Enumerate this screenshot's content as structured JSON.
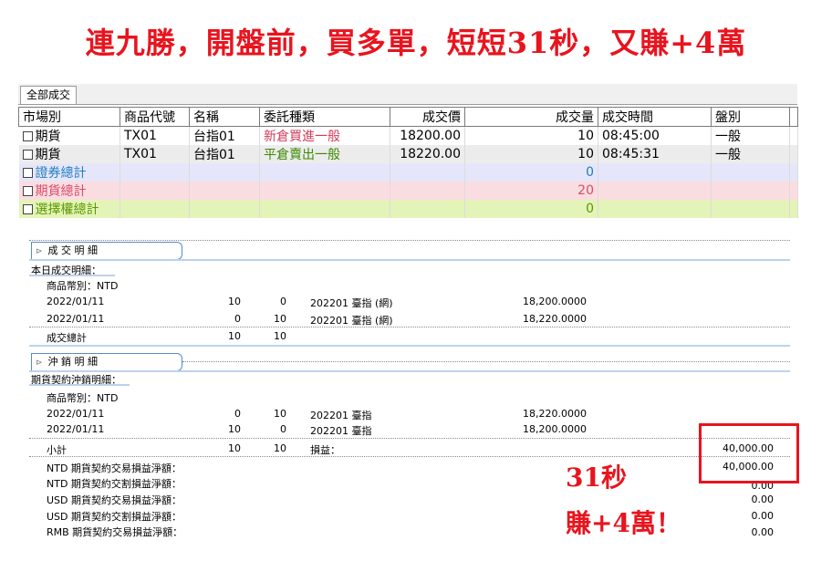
{
  "headline": "連九勝，開盤前，買多單，短短31秒，又賺+4萬",
  "tab": "全部成交",
  "columns": [
    "市場別",
    "商品代號",
    "名稱",
    "委託種類",
    "成交價",
    "成交量",
    "成交時間",
    "盤別"
  ],
  "rows": [
    {
      "market": "期貨",
      "code": "TX01",
      "name": "台指01",
      "type": "新倉買進一般",
      "price": "18200.00",
      "qty": "10",
      "time": "08:45:00",
      "session": "一般"
    },
    {
      "market": "期貨",
      "code": "TX01",
      "name": "台指01",
      "type": "平倉賣出一般",
      "price": "18220.00",
      "qty": "10",
      "time": "08:45:31",
      "session": "一般"
    }
  ],
  "totals": [
    {
      "label": "證券總計",
      "qty": "0"
    },
    {
      "label": "期貨總計",
      "qty": "20"
    },
    {
      "label": "選擇權總計",
      "qty": "0"
    }
  ],
  "trade_detail": {
    "header": "成 交 明 細",
    "title": "本日成交明細：",
    "currency": "商品幣別：NTD",
    "lines": [
      {
        "date": "2022/01/11",
        "buy": "10",
        "sell": "0",
        "contract": "202201 臺指 (網)",
        "price": "18,200.0000"
      },
      {
        "date": "2022/01/11",
        "buy": "0",
        "sell": "10",
        "contract": "202201 臺指 (網)",
        "price": "18,220.0000"
      }
    ],
    "total_label": "成交總計",
    "total_buy": "10",
    "total_sell": "10"
  },
  "offset_detail": {
    "header": "沖 銷 明 細",
    "title": "期貨契約沖銷明細：",
    "currency": "商品幣別：NTD",
    "lines": [
      {
        "date": "2022/01/11",
        "buy": "0",
        "sell": "10",
        "contract": "202201 臺指",
        "price": "18,220.0000"
      },
      {
        "date": "2022/01/11",
        "buy": "10",
        "sell": "0",
        "contract": "202201 臺指",
        "price": "18,200.0000"
      }
    ],
    "subtotal_label": "小計",
    "subtotal_buy": "10",
    "subtotal_sell": "10",
    "pl_label": "損益：",
    "pl_value": "40,000.00",
    "summary": [
      {
        "label": "NTD 期貨契約交易損益淨額：",
        "value": "40,000.00"
      },
      {
        "label": "NTD 期貨契約交割損益淨額：",
        "value": "0.00"
      },
      {
        "label": "USD 期貨契約交易損益淨額：",
        "value": "0.00"
      },
      {
        "label": "USD 期貨契約交割損益淨額：",
        "value": "0.00"
      },
      {
        "label": "RMB 期貨契約交易損益淨額：",
        "value": "0.00"
      }
    ]
  },
  "note_line1": "31秒",
  "note_line2": "賺+4萬！",
  "colors": {
    "accent_red": "#e8141e",
    "open_buy": "#d23b5a",
    "close_sell": "#3a8a00"
  }
}
